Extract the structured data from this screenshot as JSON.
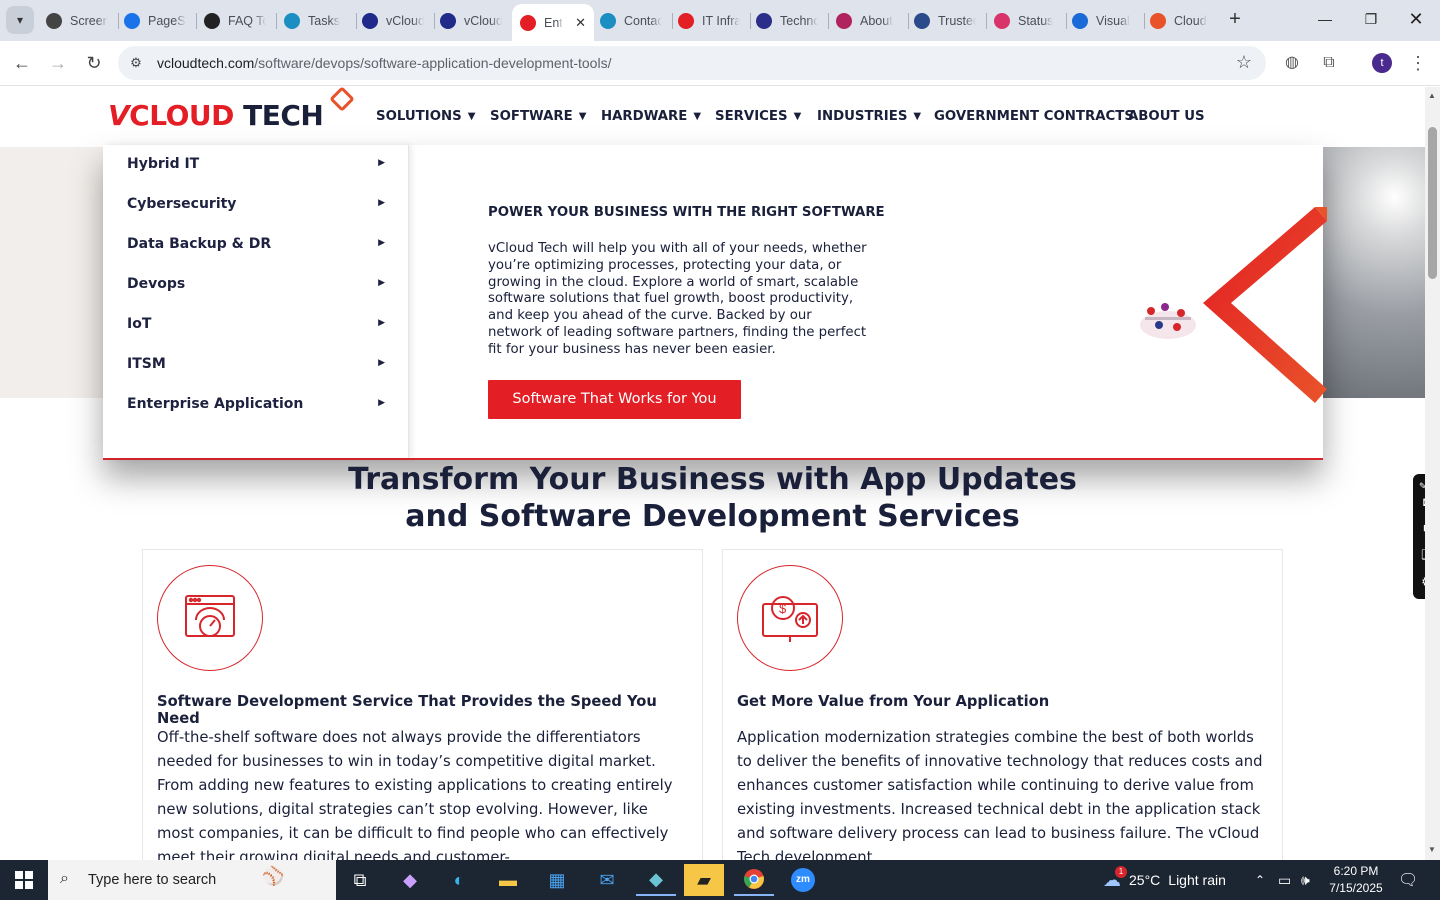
{
  "browser": {
    "tabs": [
      {
        "label": "Screencastify",
        "icon": "screencastify-icon",
        "color": "#444444"
      },
      {
        "label": "PageSpeed Insights",
        "icon": "pagespeed-icon",
        "color": "#1a73e8"
      },
      {
        "label": "FAQ Tool",
        "icon": "faq-icon",
        "color": "#222222"
      },
      {
        "label": "Tasks",
        "icon": "tasks-icon",
        "color": "#1b8ec2"
      },
      {
        "label": "vCloud Tech",
        "icon": "vcloud-v-icon",
        "color": "#1f2a8a"
      },
      {
        "label": "vCloud Tech",
        "icon": "vcloud-check-icon",
        "color": "#1f2a8a"
      },
      {
        "label": "Enterprise",
        "icon": "vcloud-diamond-icon",
        "color": "#e31e24"
      },
      {
        "label": "Contact",
        "icon": "contact-icon",
        "color": "#1b8ec2"
      },
      {
        "label": "IT Infrastructure",
        "icon": "vcloud-diamond-icon",
        "color": "#e31e24"
      },
      {
        "label": "Technology",
        "icon": "x-icon",
        "color": "#2b2f8a"
      },
      {
        "label": "About",
        "icon": "about-icon",
        "color": "#b0235e"
      },
      {
        "label": "Trusted",
        "icon": "scales-icon",
        "color": "#2a4a8a"
      },
      {
        "label": "Status",
        "icon": "status-icon",
        "color": "#d8336b"
      },
      {
        "label": "Visual",
        "icon": "visual-icon",
        "color": "#1a6ad8"
      },
      {
        "label": "Cloud",
        "icon": "cloud-icon",
        "color": "#e8532a"
      }
    ],
    "active_tab_index": 6,
    "url_host": "vcloudtech.com",
    "url_path": "/software/devops/software-application-development-tools/",
    "profile_initial": "t"
  },
  "site": {
    "logo": {
      "v": "V",
      "cloud": "CLOUD",
      "tech": "TECH"
    },
    "nav": [
      {
        "label": "SOLUTIONS",
        "has_caret": true
      },
      {
        "label": "SOFTWARE",
        "has_caret": true
      },
      {
        "label": "HARDWARE",
        "has_caret": true
      },
      {
        "label": "SERVICES",
        "has_caret": true
      },
      {
        "label": "INDUSTRIES",
        "has_caret": true
      },
      {
        "label": "GOVERNMENT CONTRACTS",
        "has_caret": false
      },
      {
        "label": "ABOUT US",
        "has_caret": false
      }
    ],
    "mega_menu": {
      "items": [
        "Hybrid IT",
        "Cybersecurity",
        "Data Backup & DR",
        "Devops",
        "IoT",
        "ITSM",
        "Enterprise Application"
      ],
      "heading": "POWER YOUR BUSINESS WITH THE RIGHT SOFTWARE",
      "text": "vCloud Tech will help you with all of your needs, whether you’re optimizing processes, protecting your data, or growing in the cloud. Explore a world of smart, scalable software solutions that fuel growth, boost productivity, and keep you ahead of the curve. Backed by our network of leading software partners, finding the perfect fit for your business has never been easier.",
      "cta": "Software That Works for You"
    },
    "section_title_line1": "Transform Your Business with App Updates",
    "section_title_line2": "and Software Development Services",
    "cards": [
      {
        "title": "Software Development Service That Provides the Speed You Need",
        "text": "Off-the-shelf software does not always provide the differentiators needed for businesses to win in today’s competitive digital market. From adding new features to existing applications to creating entirely new solutions, digital strategies can’t stop evolving. However, like most companies, it can be difficult to find people who can effectively meet their growing digital needs and customer-"
      },
      {
        "title": "Get More Value from Your Application",
        "text": "Application modernization strategies combine the best of both worlds to deliver the benefits of innovative technology that reduces costs and enhances customer satisfaction while continuing to derive value from existing investments. Increased technical debt in the application stack and software delivery process can lead to business failure. The vCloud Tech development"
      }
    ],
    "brand_red": "#e31e24",
    "navy": "#1a1f3a"
  },
  "taskbar": {
    "search_placeholder": "Type here to search",
    "weather_temp": "25°C",
    "weather_text": "Light rain",
    "weather_badge": "1",
    "time": "6:20 PM",
    "date": "7/15/2025"
  }
}
